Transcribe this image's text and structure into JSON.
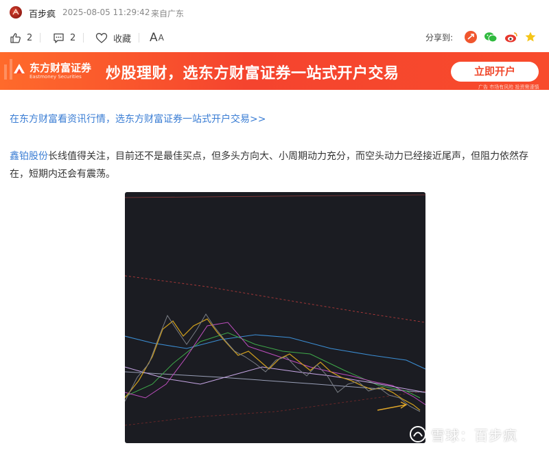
{
  "header": {
    "author": "百步疯",
    "timestamp": "2025-08-05 11:29:42",
    "source": "来自广东",
    "avatar_icon": "avatar-icon"
  },
  "actions": {
    "like_count": "2",
    "comment_count": "2",
    "favorite_label": "收藏",
    "font_size_label": "A",
    "font_size_label_small": "A",
    "share_label": "分享到:"
  },
  "share_icons": [
    "repost-icon",
    "wechat-icon",
    "weibo-icon",
    "star-icon"
  ],
  "colors": {
    "link": "#3a7dd4",
    "banner": "#f5442e",
    "chart_bg": "#1b1c22"
  },
  "banner": {
    "brand": "东方财富证券",
    "brand_en": "Eastmoney Securities",
    "slogan": "炒股理财，选东方财富证券一站式开户交易",
    "cta": "立即开户",
    "disclaimer": "广告 市场有风险 投资需谨慎"
  },
  "content": {
    "promo_link": "在东方财富看资讯行情，选东方财富证券一站式开户交易>>",
    "stock_name": "鑫铂股份",
    "paragraph": "长线值得关注，目前还不是最佳买点，但多头方向大、小周期动力充分，而空头动力已经接近尾声，但阻力依然存在，短期内还会有震荡。"
  },
  "watermark": {
    "text": "雪球：百步疯"
  }
}
